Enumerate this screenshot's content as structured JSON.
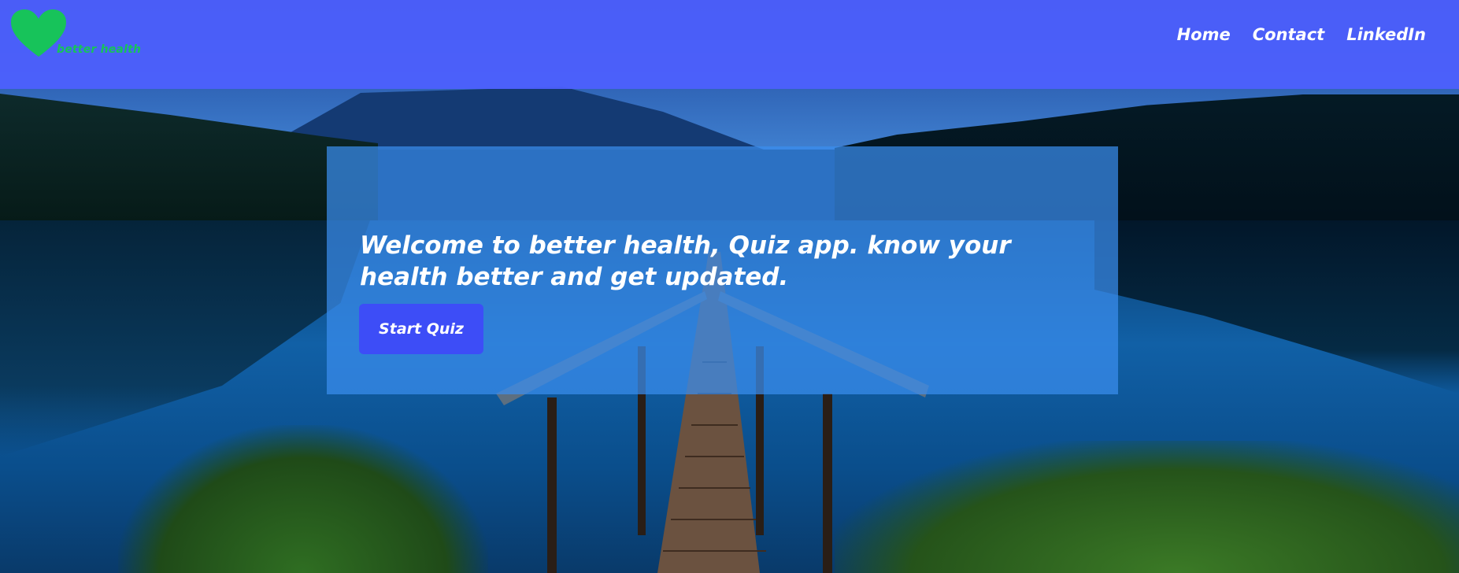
{
  "brand": {
    "name": "better health",
    "icon": "heart-icon",
    "color": "#17c35a"
  },
  "nav": {
    "items": [
      {
        "label": "Home"
      },
      {
        "label": "Contact"
      },
      {
        "label": "LinkedIn"
      }
    ]
  },
  "hero": {
    "title": "Welcome to better health, Quiz app. know your health better and get updated.",
    "button_label": "Start Quiz"
  },
  "colors": {
    "header_bg": "#4e60ff",
    "button_bg": "#3d4df7",
    "hero_panel": "#3a8eee"
  }
}
